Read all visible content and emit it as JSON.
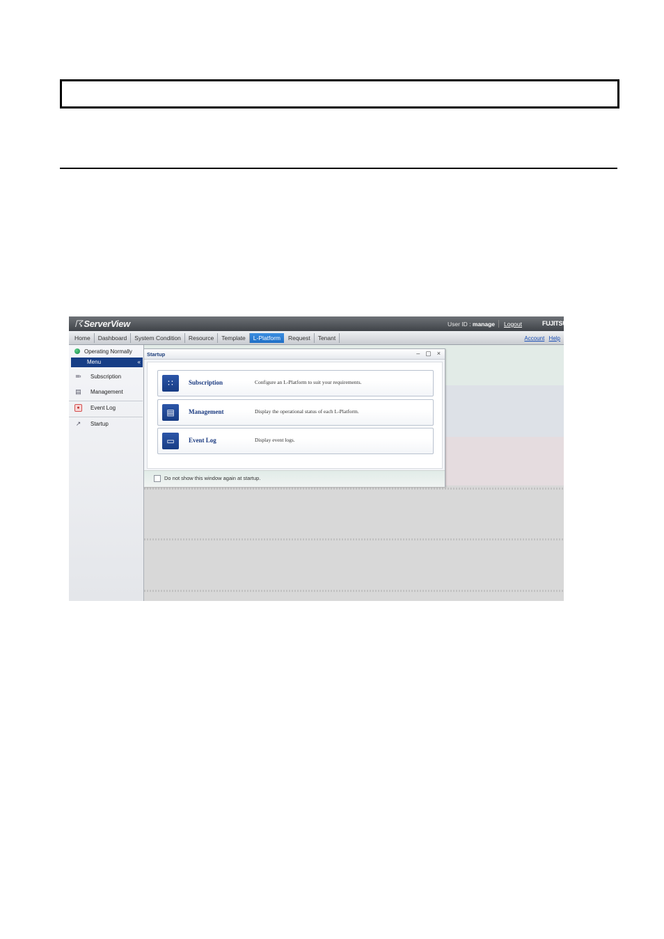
{
  "app": {
    "brand": "ServerView",
    "brand_mark": "☈",
    "user_id_label": "User ID : ",
    "user_id_value": "manage",
    "logout_label": "Logout",
    "vendor_logo": "FUJITSU"
  },
  "nav": {
    "tabs": [
      {
        "label": "Home",
        "active": false
      },
      {
        "label": "Dashboard",
        "active": false
      },
      {
        "label": "System Condition",
        "active": false
      },
      {
        "label": "Resource",
        "active": false
      },
      {
        "label": "Template",
        "active": false
      },
      {
        "label": "L-Platform",
        "active": true
      },
      {
        "label": "Request",
        "active": false
      },
      {
        "label": "Tenant",
        "active": false
      }
    ],
    "account_label": "Account",
    "help_label": "Help"
  },
  "sidebar": {
    "status_text": "Operating Normally",
    "menu_label": "Menu",
    "collapse_glyph": "«",
    "items": [
      {
        "label": "Subscription",
        "icon": "subscription-icon"
      },
      {
        "label": "Management",
        "icon": "management-icon"
      },
      {
        "label": "Event Log",
        "icon": "event-log-icon"
      },
      {
        "label": "Startup",
        "icon": "startup-icon"
      }
    ]
  },
  "dialog": {
    "title": "Startup",
    "controls": {
      "minimize": "–",
      "restore": "▢",
      "close": "×"
    },
    "cards": [
      {
        "title": "Subscription",
        "description": "Configure an L-Platform to suit your requirements.",
        "icon": "subscription-icon"
      },
      {
        "title": "Management",
        "description": "Display the operational status of each L-Platform.",
        "icon": "management-icon"
      },
      {
        "title": "Event Log",
        "description": "Display event logs.",
        "icon": "event-log-icon"
      }
    ],
    "checkbox_label": "Do not show this window again at startup.",
    "checkbox_checked": false
  },
  "colors": {
    "header_dark": "#3f4348",
    "active_tab": "#1f6fc6",
    "menu_bar": "#173e86",
    "card_title": "#1a3a80",
    "status_ok": "#138245"
  }
}
